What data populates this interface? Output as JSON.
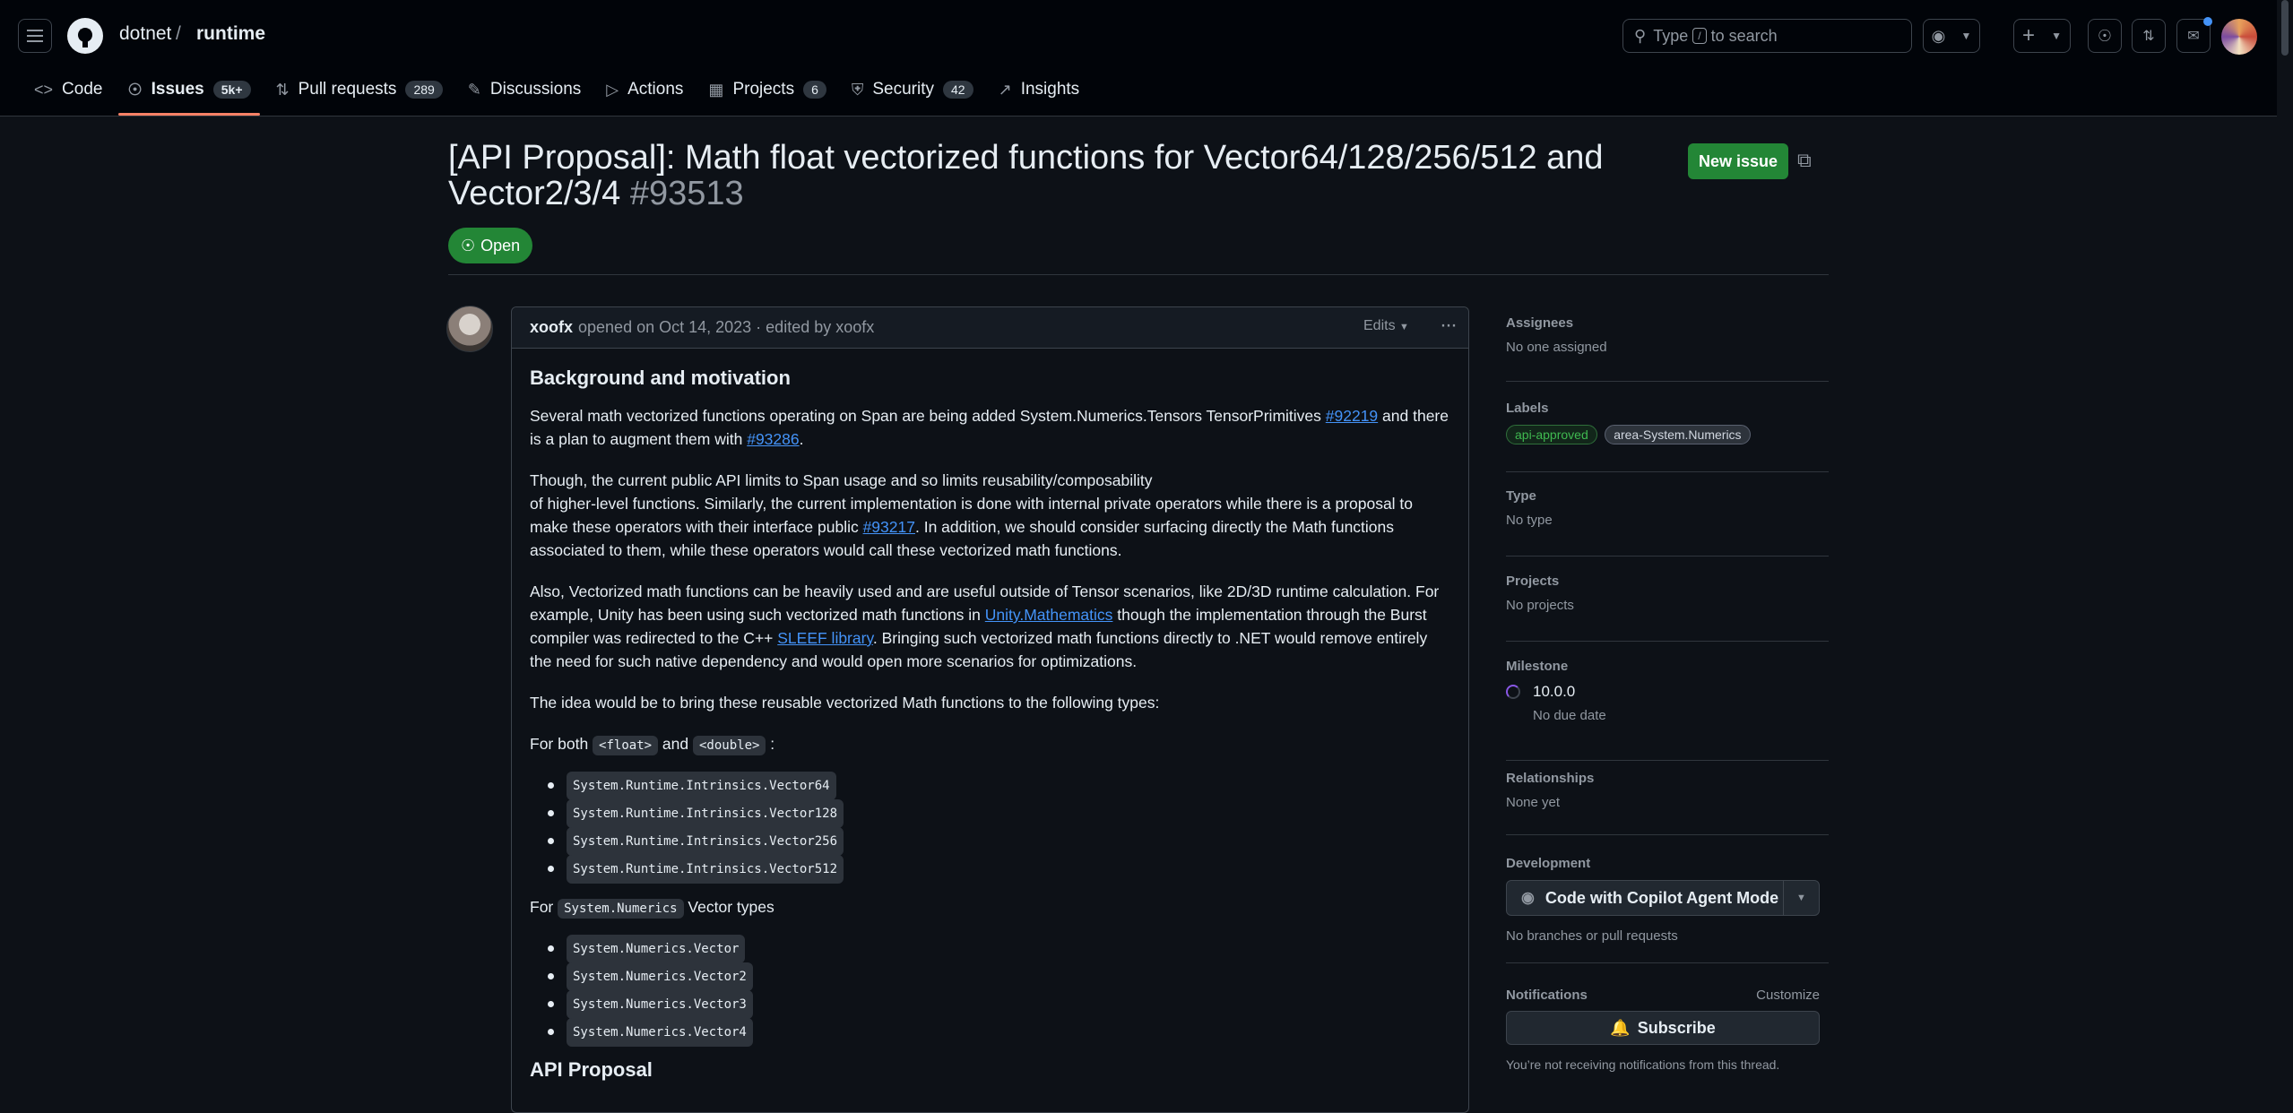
{
  "header": {
    "owner": "dotnet",
    "separator": "/",
    "repo": "runtime",
    "search_pre": "Type",
    "search_key": "/",
    "search_post": "to search",
    "plus": "+"
  },
  "tabs": [
    {
      "label": "Code",
      "count": ""
    },
    {
      "label": "Issues",
      "count": "5k+"
    },
    {
      "label": "Pull requests",
      "count": "289"
    },
    {
      "label": "Discussions",
      "count": ""
    },
    {
      "label": "Actions",
      "count": ""
    },
    {
      "label": "Projects",
      "count": "6"
    },
    {
      "label": "Security",
      "count": "42"
    },
    {
      "label": "Insights",
      "count": ""
    }
  ],
  "issue": {
    "title": "[API Proposal]: Math float vectorized functions for Vector64/128/256/512 and Vector2/3/4",
    "number": "#93513",
    "new_issue_label": "New issue",
    "state": "Open"
  },
  "comment": {
    "author": "xoofx",
    "meta": "opened on Oct 14, 2023 · edited by xoofx",
    "edits_label": "Edits",
    "heading": "Background and motivation",
    "p1a": "Several math vectorized functions operating on Span are being added System.Numerics.Tensors TensorPrimitives ",
    "p1_link1": "#92219",
    "p1b": " and there is a plan to augment them with ",
    "p1_link2": "#93286",
    "p1c": ".",
    "p2a": "Though, the current public API limits to Span usage and so limits reusability/composability",
    "p2b": "of higher-level functions. Similarly, the current implementation is done with internal private operators while there is a proposal to make these operators with their interface public ",
    "p2_link": "#93217",
    "p2c": ". In addition, we should consider surfacing directly the Math functions associated to them, while these operators would call these vectorized math functions.",
    "p3a": "Also, Vectorized math functions can be heavily used and are useful outside of Tensor scenarios, like 2D/3D runtime calculation. For example, Unity has been using such vectorized math functions in ",
    "p3_link1": "Unity.Mathematics",
    "p3b": " though the implementation through the Burst compiler was redirected to the C++ ",
    "p3_link2": "SLEEF library",
    "p3c": ". Bringing such vectorized math functions directly to .NET would remove entirely the need for such native dependency and would open more scenarios for optimizations.",
    "p4": "The idea would be to bring these reusable vectorized Math functions to the following types:",
    "p5_pre": "For both ",
    "p5_code1": "<float>",
    "p5_mid": " and ",
    "p5_code2": "<double>",
    "p5_post": " :",
    "list1": [
      "System.Runtime.Intrinsics.Vector64",
      "System.Runtime.Intrinsics.Vector128",
      "System.Runtime.Intrinsics.Vector256",
      "System.Runtime.Intrinsics.Vector512"
    ],
    "p6_pre": "For ",
    "p6_code": "System.Numerics",
    "p6_post": " Vector types",
    "list2": [
      "System.Numerics.Vector",
      "System.Numerics.Vector2",
      "System.Numerics.Vector3",
      "System.Numerics.Vector4"
    ],
    "heading2": "API Proposal"
  },
  "sidebar": {
    "assignees_h": "Assignees",
    "assignees_v": "No one assigned",
    "labels_h": "Labels",
    "label1": "api-approved",
    "label2": "area-System.Numerics",
    "type_h": "Type",
    "type_v": "No type",
    "projects_h": "Projects",
    "projects_v": "No projects",
    "milestone_h": "Milestone",
    "milestone_name": "10.0.0",
    "milestone_due": "No due date",
    "relationships_h": "Relationships",
    "relationships_v": "None yet",
    "development_h": "Development",
    "copilot_label": "Code with Copilot Agent Mode",
    "development_v": "No branches or pull requests",
    "notifications_h": "Notifications",
    "customize": "Customize",
    "subscribe_label": "Subscribe",
    "notifications_v": "You’re not receiving notifications from this thread."
  },
  "colors": {
    "accent": "#238636",
    "link": "#4493f8",
    "tab_underline": "#f78166"
  }
}
